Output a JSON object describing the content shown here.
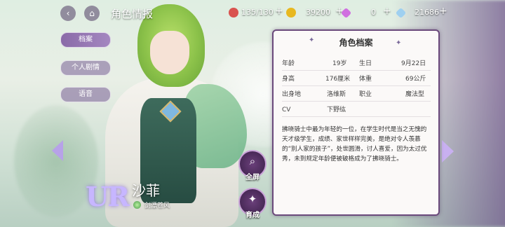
{
  "header": {
    "title": "角色情报",
    "resources": [
      {
        "name": "stamina",
        "icon": "meat-icon",
        "value": "135/130",
        "color": "#d9534f"
      },
      {
        "name": "gold",
        "icon": "coin-icon",
        "value": "39200",
        "color": "#e8b820"
      },
      {
        "name": "premium-gem",
        "icon": "gem-icon",
        "value": "0",
        "color": "#d070e0"
      },
      {
        "name": "diamond",
        "icon": "diamond-icon",
        "value": "21686",
        "color": "#9fd0f0"
      }
    ]
  },
  "menu": {
    "items": [
      {
        "label": "档案",
        "active": true
      },
      {
        "label": "个人剧情",
        "active": false
      },
      {
        "label": "语音",
        "active": false
      }
    ]
  },
  "character": {
    "rarity": "UR",
    "name": "沙菲",
    "subtitle": "剑漂苍风"
  },
  "actions": {
    "fullscreen": "全屏",
    "develop": "育成"
  },
  "profile": {
    "title": "角色档案",
    "fields": [
      {
        "k1": "年龄",
        "v1": "19岁",
        "k2": "生日",
        "v2": "9月22日"
      },
      {
        "k1": "身高",
        "v1": "176厘米",
        "k2": "体重",
        "v2": "69公斤"
      },
      {
        "k1": "出身地",
        "v1": "洛维斯",
        "k2": "职业",
        "v2": "魔法型"
      },
      {
        "k1": "CV",
        "v1": "下野纮",
        "k2": "",
        "v2": ""
      }
    ],
    "bio": "拂晓骑士中最为年轻的一位，在学生时代是当之无愧的天才级学生，成绩、家世样样完美，是绝对令人羡慕的“别人家的孩子”，处世圆滑，讨人喜爱，因为太过优秀，未到规定年龄便被破格成为了拂晓骑士。"
  },
  "colors": {
    "accent": "#6b4a7c",
    "menu_active": "#8a6aa8"
  }
}
